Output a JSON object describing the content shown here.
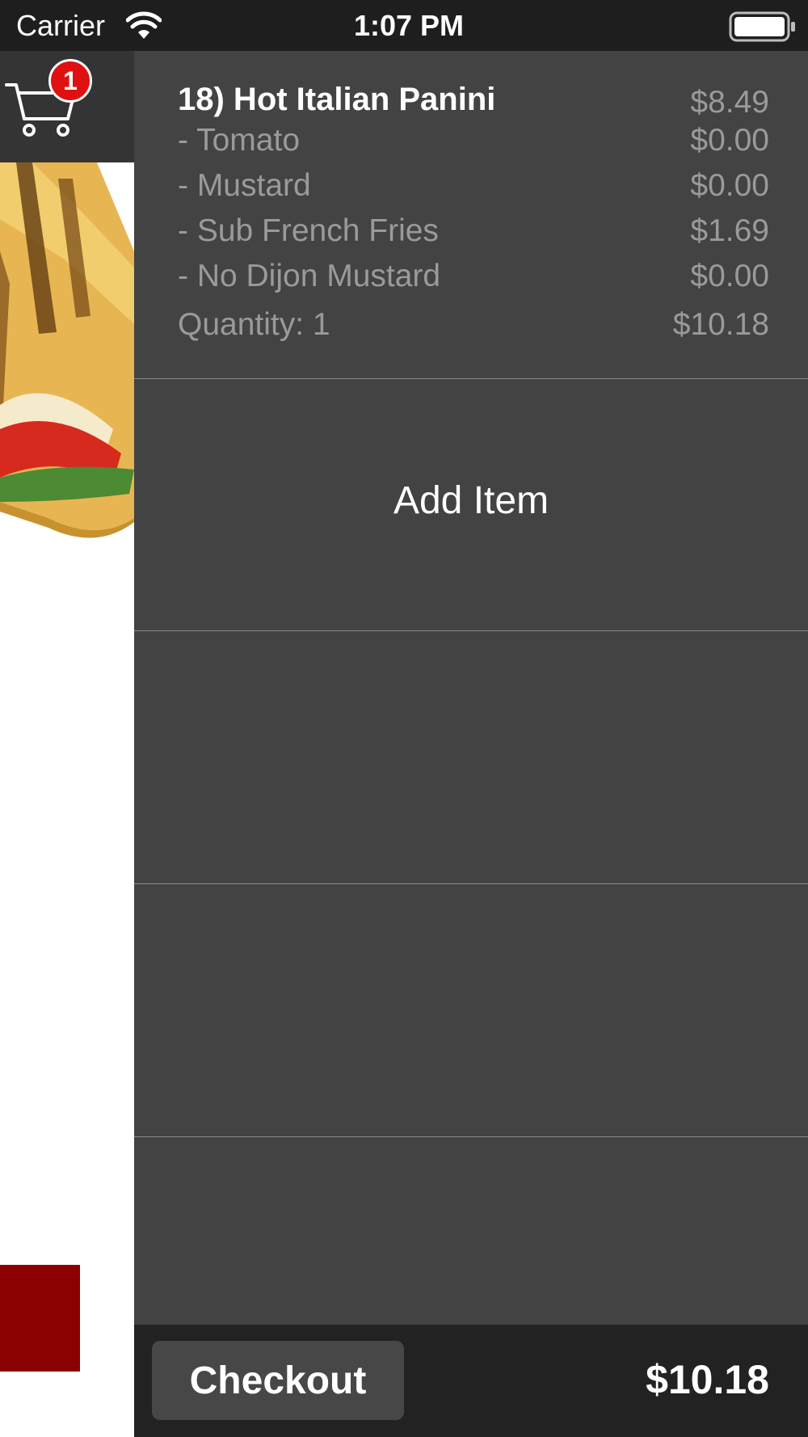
{
  "status_bar": {
    "carrier": "Carrier",
    "time": "1:07 PM",
    "wifi_icon": "wifi-icon",
    "battery_icon": "battery-icon"
  },
  "cart": {
    "icon": "cart-icon",
    "badge_count": "1"
  },
  "order": {
    "item_title": "18) Hot Italian Panini",
    "item_price": "$8.49",
    "modifiers": [
      {
        "label": " - Tomato",
        "price": "$0.00"
      },
      {
        "label": " - Mustard",
        "price": "$0.00"
      },
      {
        "label": " - Sub French Fries",
        "price": "$1.69"
      },
      {
        "label": " - No Dijon Mustard",
        "price": "$0.00"
      }
    ],
    "quantity_label": "Quantity: 1",
    "line_total": "$10.18"
  },
  "actions": {
    "add_item_label": "Add Item",
    "checkout_label": "Checkout",
    "total": "$10.18"
  },
  "colors": {
    "drawer_background": "#434343",
    "bottom_bar": "#222222",
    "badge": "#e01010",
    "accent_block": "#8b0000"
  }
}
